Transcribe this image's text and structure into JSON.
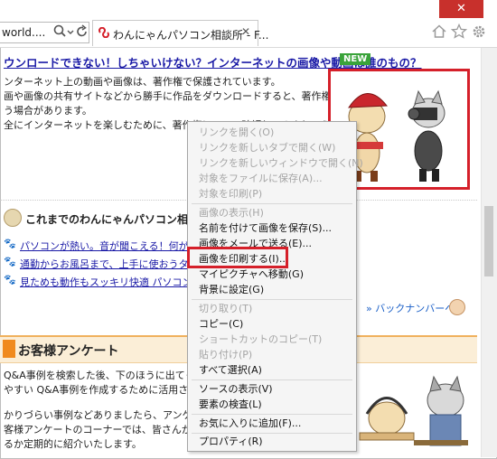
{
  "window": {
    "close_glyph": "✕"
  },
  "address_bar": {
    "text": "world....",
    "search_icon": "search-icon",
    "dropdown_icon": "chevron-down-icon",
    "refresh_icon": "refresh-icon"
  },
  "tab": {
    "title": "わんにゃんパソコン相談所 - F...",
    "close_glyph": "✕"
  },
  "right_icons": [
    "home-icon",
    "star-icon",
    "gear-icon"
  ],
  "page": {
    "headline": "ウンロードできない！しちゃいけない？インターネットの画像や動画は誰のもの？",
    "new_badge": "NEW",
    "para1": [
      "ンターネット上の動画や画像は、著作権で保護されています。",
      "画や画像の共有サイトなどから勝手に作品をダウンロードすると、著作権を侵害してし",
      "う場合があります。",
      "全にインターネットを楽しむために、著作権について確認してみましょう。"
    ],
    "section_title": "これまでのわんにゃんパソコン相談所",
    "links": [
      "パソコンが熱い。音が聞こえる！何がパソコ",
      "通勤からお風呂まで、上手に使おうタブレッ",
      "見ためも動作もスッキリ快適 パソコンお手"
    ],
    "back_number": "バックナンバーへ",
    "survey_title": "お客様アンケート",
    "para2": [
      "Q&A事例を検索した後、下のほうに出てくるアンケ",
      "やすい Q&A事例を作成するために活用されて",
      "",
      "かりづらい事例などありましたら、アンケートに",
      "客様アンケートのコーナーでは、皆さんからいた",
      "るか定期的に紹介いたします。"
    ]
  },
  "context_menu": {
    "items": [
      {
        "label": "リンクを開く(O)",
        "enabled": false
      },
      {
        "label": "リンクを新しいタブで開く(W)",
        "enabled": false
      },
      {
        "label": "リンクを新しいウィンドウで開く(N)",
        "enabled": false
      },
      {
        "label": "対象をファイルに保存(A)...",
        "enabled": false
      },
      {
        "label": "対象を印刷(P)",
        "enabled": false
      },
      {
        "label": "画像の表示(H)",
        "enabled": false
      },
      {
        "label": "名前を付けて画像を保存(S)...",
        "enabled": true
      },
      {
        "label": "画像をメールで送る(E)...",
        "enabled": true
      },
      {
        "label": "画像を印刷する(I)...",
        "enabled": true
      },
      {
        "label": "マイピクチャへ移動(G)",
        "enabled": true
      },
      {
        "label": "背景に設定(G)",
        "enabled": true
      },
      {
        "label": "切り取り(T)",
        "enabled": false
      },
      {
        "label": "コピー(C)",
        "enabled": true
      },
      {
        "label": "ショートカットのコピー(T)",
        "enabled": false
      },
      {
        "label": "貼り付け(P)",
        "enabled": false
      },
      {
        "label": "すべて選択(A)",
        "enabled": true
      },
      {
        "label": "ソースの表示(V)",
        "enabled": true
      },
      {
        "label": "要素の検査(L)",
        "enabled": true
      },
      {
        "label": "お気に入りに追加(F)...",
        "enabled": true
      },
      {
        "label": "プロパティ(R)",
        "enabled": true
      }
    ],
    "highlighted_item": "画像を印刷する(I)..."
  },
  "colors": {
    "highlight_border": "#d5202a",
    "link": "#1a1aa6",
    "new_badge": "#3aa33a",
    "survey_accent": "#f08a1e"
  }
}
